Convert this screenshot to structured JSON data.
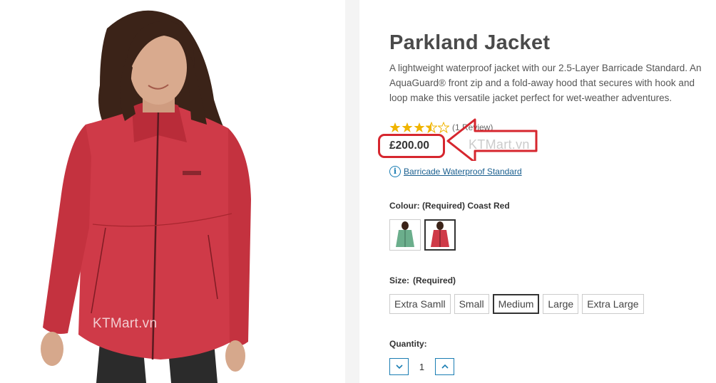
{
  "product": {
    "title": "Parkland Jacket",
    "description": "A lightweight waterproof jacket with our 2.5-Layer Barricade Standard. An AquaGuard® front zip and a fold-away hood that secures with hook and loop make this versatile jacket perfect for wet-weather adventures.",
    "rating": 3.5,
    "rating_max": 5,
    "review_count_text": "(1 Review)",
    "price": "£200.00",
    "standard_link": "Barricade Waterproof Standard"
  },
  "colour": {
    "label": "Colour: (Required) Coast Red",
    "options": [
      {
        "name": "green",
        "color": "#6bae8c",
        "selected": false
      },
      {
        "name": "coast-red",
        "color": "#cf3a48",
        "selected": true
      }
    ]
  },
  "size": {
    "label": "Size:",
    "required": "(Required)",
    "options": [
      "Extra Samll",
      "Small",
      "Medium",
      "Large",
      "Extra Large"
    ],
    "selected": "Medium"
  },
  "quantity": {
    "label": "Quantity:",
    "value": "1"
  },
  "watermarks": {
    "left": "KTMart.vn",
    "right": "KTMart.vn"
  },
  "colors": {
    "jacket": "#cf3a48",
    "annotation": "#d6262e",
    "link": "#1a5f8f",
    "star": "#f0b400"
  }
}
